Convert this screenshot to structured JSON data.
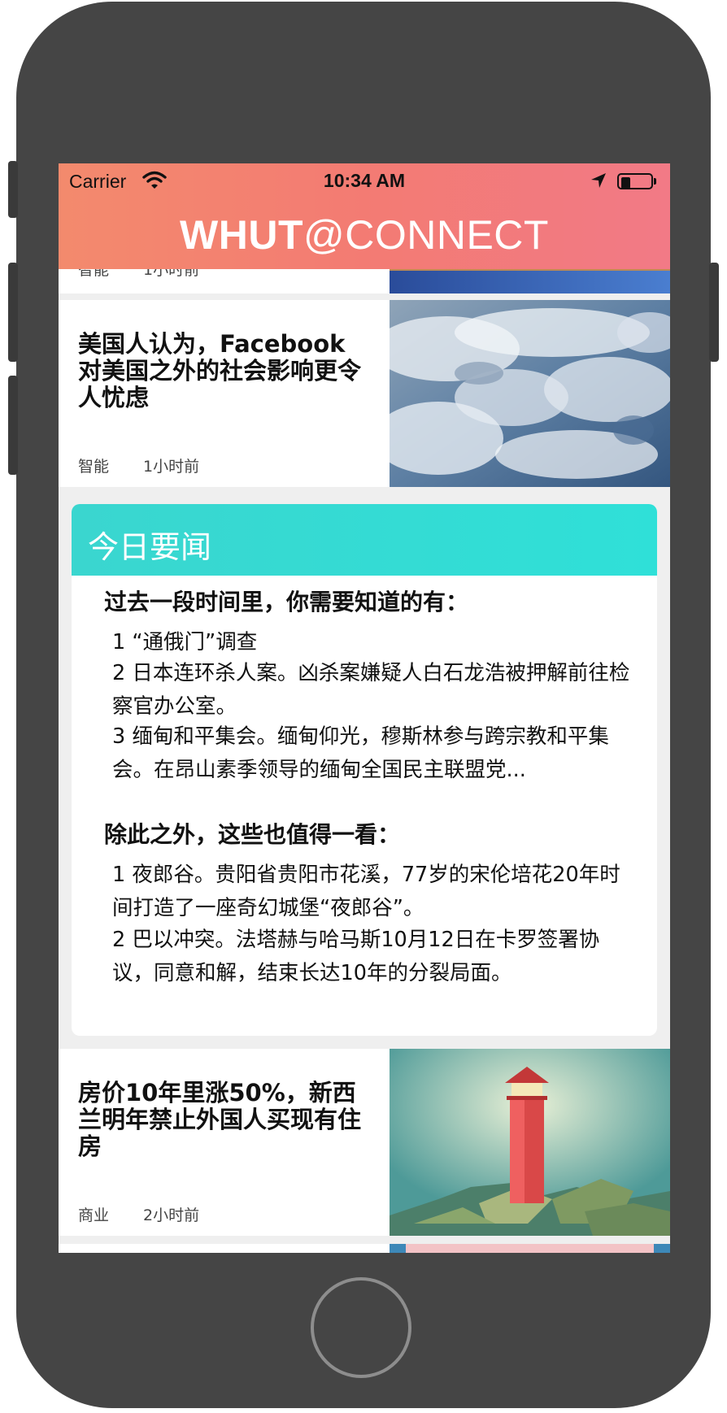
{
  "status_bar": {
    "carrier": "Carrier",
    "time": "10:34 AM"
  },
  "header": {
    "brand_bold": "WHUT",
    "brand_rest": "@CONNECT"
  },
  "colors": {
    "header_gradient": [
      "#f38a6d",
      "#f27a86"
    ],
    "digest_header": "#33dcd4",
    "phone_frame": "#454545"
  },
  "feed": {
    "previous_card": {
      "category": "智能",
      "time": "1小时前"
    },
    "cards": [
      {
        "title": "美国人认为，Facebook对美国之外的社会影响更令人忧虑",
        "category": "智能",
        "time": "1小时前",
        "image": "earth-clouds-photo"
      },
      {
        "title": "房价10年里涨50%，新西兰明年禁止外国人买现有住房",
        "category": "商业",
        "time": "2小时前",
        "image": "lowpoly-lighthouse-illustration"
      }
    ]
  },
  "digest": {
    "title": "今日要闻",
    "section1_heading": "过去一段时间里，你需要知道的有：",
    "section1_items": [
      "1 “通俄门”调查",
      "2 日本连环杀人案。凶杀案嫌疑人白石龙浩被押解前往检察官办公室。",
      "3 缅甸和平集会。缅甸仰光，穆斯林参与跨宗教和平集会。在昂山素季领导的缅甸全国民主联盟党..."
    ],
    "section2_heading": "除此之外，这些也值得一看：",
    "section2_items": [
      "1 夜郎谷。贵阳省贵阳市花溪，77岁的宋伦培花20年时间打造了一座奇幻城堡“夜郎谷”。",
      "2 巴以冲突。法塔赫与哈马斯10月12日在卡罗签署协议，同意和解，结束长达10年的分裂局面。"
    ]
  }
}
